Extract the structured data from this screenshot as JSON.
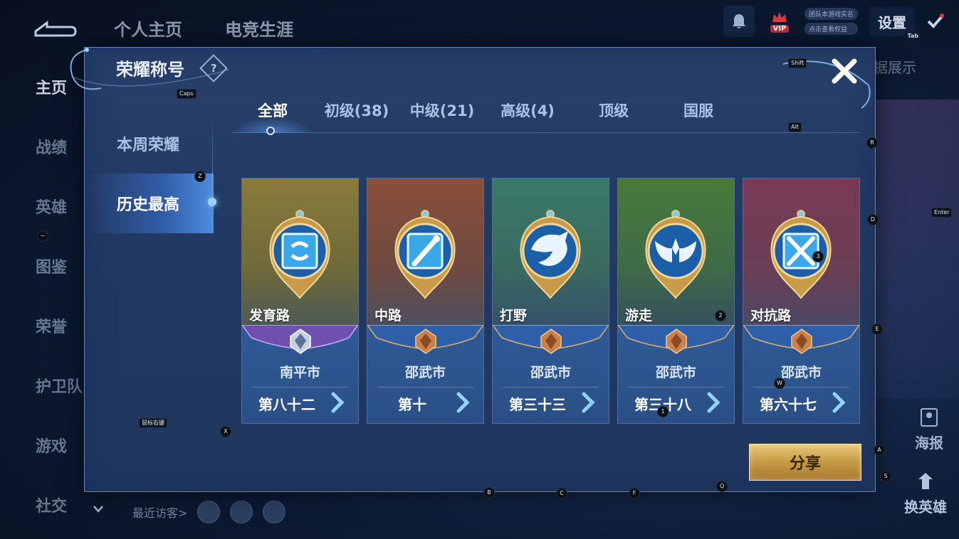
{
  "background": {
    "top_nav": [
      "个人主页",
      "电竞生涯"
    ],
    "side_nav": [
      "主页",
      "战绩",
      "英雄",
      "图鉴",
      "荣誉",
      "护卫队",
      "游戏",
      "社交"
    ],
    "settings_label": "设置",
    "settings_key": "Tab",
    "vip_label": "VIP",
    "vip_lines": [
      "团队本游戏实名",
      "点击查看权益"
    ],
    "right_label": "据展示",
    "poster_label": "海报",
    "hero_label": "换英雄",
    "recent_visitors_label": "最近访客>"
  },
  "modal": {
    "title": "荣耀称号",
    "help_glyph": "?",
    "categories": [
      {
        "label": "本周荣耀",
        "active": false
      },
      {
        "label": "历史最高",
        "active": true
      }
    ],
    "tabs": [
      {
        "label": "全部",
        "active": true
      },
      {
        "label": "初级(38)",
        "active": false
      },
      {
        "label": "中级(21)",
        "active": false
      },
      {
        "label": "高级(4)",
        "active": false
      },
      {
        "label": "顶级",
        "active": false
      },
      {
        "label": "国服",
        "active": false
      }
    ],
    "cards": [
      {
        "lane": "发育路",
        "city": "南平市",
        "rank": "第八十二",
        "medal_icon": "marksman-icon",
        "ribbon": "purple"
      },
      {
        "lane": "中路",
        "city": "邵武市",
        "rank": "第十",
        "medal_icon": "mage-icon",
        "ribbon": "blue"
      },
      {
        "lane": "打野",
        "city": "邵武市",
        "rank": "第三十三",
        "medal_icon": "dragon-icon",
        "ribbon": "blue"
      },
      {
        "lane": "游走",
        "city": "邵武市",
        "rank": "第三十八",
        "medal_icon": "wings-icon",
        "ribbon": "blue"
      },
      {
        "lane": "对抗路",
        "city": "邵武市",
        "rank": "第六十七",
        "medal_icon": "crossed-swords-icon",
        "ribbon": "blue"
      }
    ],
    "share_label": "分享"
  },
  "key_hints": {
    "caps": "Caps",
    "shift": "Shift",
    "alt": "Alt",
    "z": "Z",
    "tilde": "~",
    "r": "R",
    "d": "D",
    "enter": "Enter",
    "e": "E",
    "w": "W",
    "three": "3",
    "two": "2",
    "one": "1",
    "x": "X",
    "mouse": "鼠标右键",
    "a": "A",
    "s": "S",
    "q": "Q",
    "b": "B",
    "c": "C",
    "f": "F"
  },
  "colors": {
    "accent": "#5f86c0",
    "share_gold": "#c69a45",
    "card_tops": [
      "#8a7a3a",
      "#8a4f3a",
      "#3a7a6a",
      "#4a7a3a",
      "#7a3a55"
    ]
  }
}
